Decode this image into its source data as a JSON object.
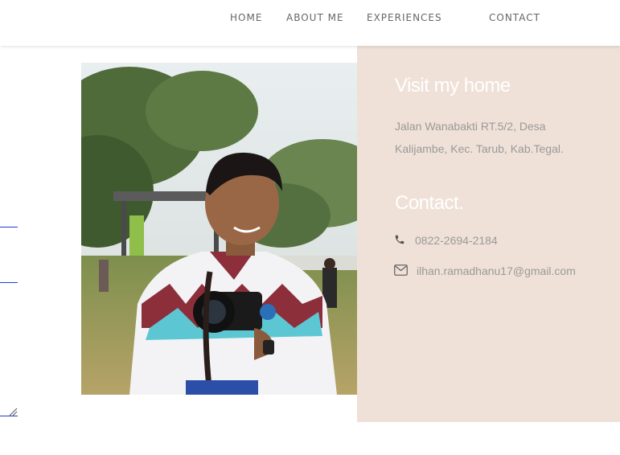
{
  "nav": {
    "home": "HOME",
    "about": "ABOUT ME",
    "experiences": "EXPERIENCES",
    "contact": "CONTACT"
  },
  "photo": {
    "description": "photo-of-man-holding-camera"
  },
  "panel": {
    "visit_title": "Visit my home",
    "address": "Jalan Wanabakti RT.5/2, Desa Kalijambe, Kec. Tarub, Kab.Tegal.",
    "contact_title": "Contact.",
    "phone": "0822-2694-2184",
    "email": "ilhan.ramadhanu17@gmail.com"
  },
  "colors": {
    "panel_bg": "#efe1d7",
    "link_blue": "#1a3fd8",
    "muted_text": "#9a9a9a"
  }
}
